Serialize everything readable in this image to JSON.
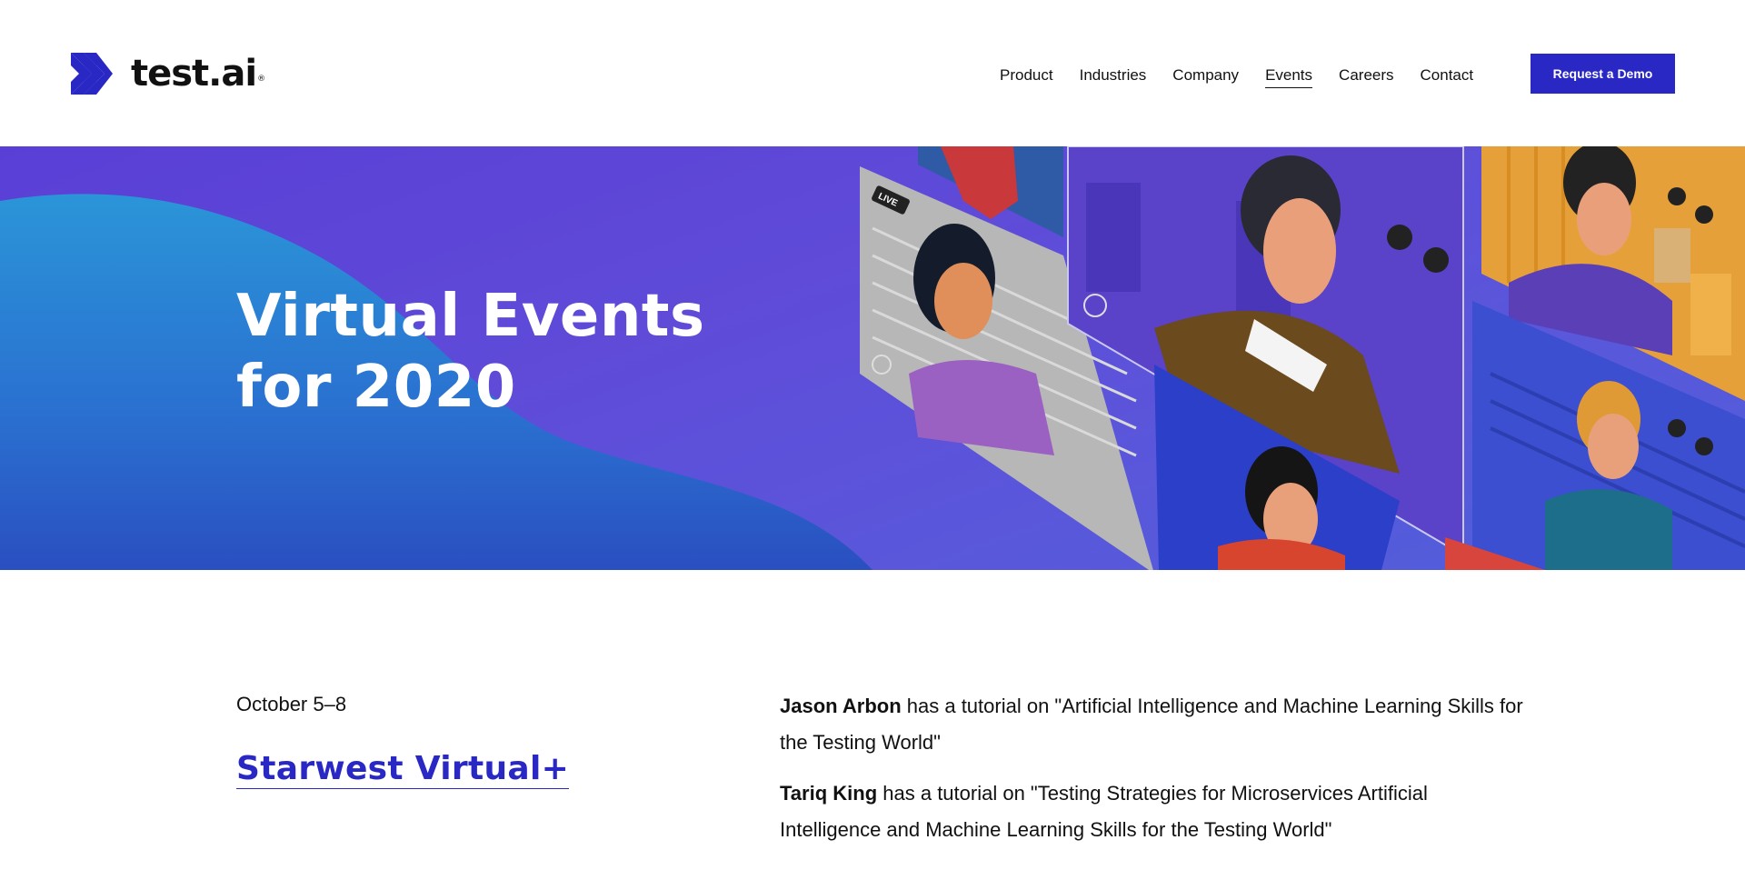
{
  "header": {
    "logo_text": "test.ai",
    "logo_tm": "®",
    "nav": [
      {
        "label": "Product"
      },
      {
        "label": "Industries"
      },
      {
        "label": "Company"
      },
      {
        "label": "Events",
        "active": true
      },
      {
        "label": "Careers"
      },
      {
        "label": "Contact"
      }
    ],
    "cta_label": "Request a Demo"
  },
  "hero": {
    "title_line1": "Virtual Events",
    "title_line2": "for 2020",
    "live_label": "LIVE"
  },
  "event": {
    "date": "October 5–8",
    "title": "Starwest Virtual+",
    "talks": [
      {
        "speaker": "Jason Arbon",
        "text": " has a tutorial on \"Artificial Intelligence and Machine Learning Skills for the Testing World\""
      },
      {
        "speaker": "Tariq King",
        "text": " has a tutorial on \"Testing Strategies for Microservices Artificial Intelligence and Machine Learning Skills for the Testing World\""
      }
    ]
  },
  "colors": {
    "brand": "#2a28c4",
    "hero_purple": "#5f4bd8",
    "hero_blue": "#2a8fd6"
  }
}
